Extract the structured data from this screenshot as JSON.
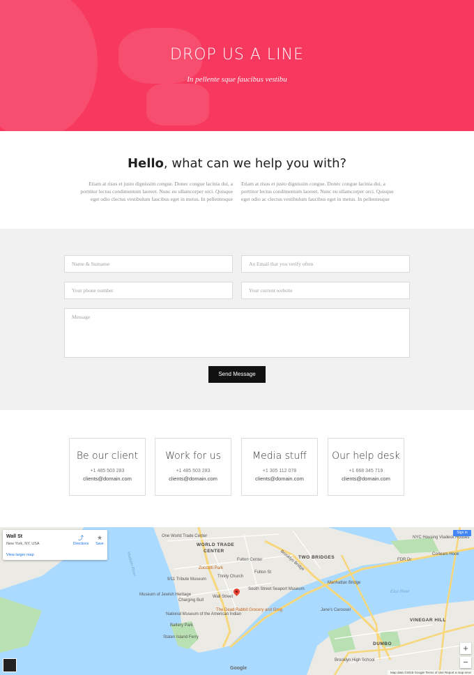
{
  "hero": {
    "title": "DROP US A LINE",
    "subtitle": "In pellente sque faucibus vestibu",
    "bg_color": "#f7395f"
  },
  "hello": {
    "title_bold": "Hello",
    "title_rest": ", what can we help you with?",
    "col_left": "Etiam at risus et justo dignissim congue. Donec congue lacinia dui, a porttitor lectus condimentum laoreet. Nunc eu ullamcorper orci. Quisque eget odio clectus vestibulum faucibus eget in metus. In pellentesque",
    "col_right": "Etiam at risus et justo dignissim congue. Donec congue lacinia dui, a porttitor lectus condimentum laoreet. Nunc eu ullamcorper orci. Quisque eget odio ac clectus vestibulum faucibus eget in metus. In pellentesque"
  },
  "form": {
    "name_placeholder": "Name & Surname",
    "email_placeholder": "An Email that you verify often",
    "phone_placeholder": "Your phone number",
    "website_placeholder": "Your current website",
    "message_placeholder": "Message",
    "send_label": "Send Message"
  },
  "cards": [
    {
      "title": "Be our client",
      "phone": "+1 485 503 283",
      "email": "clients@domain.com"
    },
    {
      "title": "Work for us",
      "phone": "+1 485 503 283",
      "email": "clients@domain.com"
    },
    {
      "title": "Media stuff",
      "phone": "+1 305 112 078",
      "email": "clients@domain.com"
    },
    {
      "title": "Our help desk",
      "phone": "+1 668 345 719",
      "email": "clients@domain.com"
    }
  ],
  "map": {
    "place_name": "Wall St",
    "place_address": "New York, NY, USA",
    "directions_label": "Directions",
    "save_label": "Save",
    "larger_map_label": "View larger map",
    "signin_label": "Sign in",
    "zoom_in": "+",
    "zoom_out": "−",
    "google_logo": "Google",
    "credits": "Map data ©2018 Google   Terms of Use   Report a map error",
    "labels": {
      "wtc": "WORLD TRADE",
      "wtc2": "CENTER",
      "two_bridges": "TWO BRIDGES",
      "vinegar_hill": "VINEGAR HILL",
      "dumbo": "DUMBO",
      "east_river": "East River",
      "hudson": "Hudson River",
      "one_wtc": "One World Trade Center",
      "fulton": "Fulton Center",
      "fulton_st": "Fulton St",
      "zuccotti": "Zuccotti Park",
      "tribute": "9/11 Tribute Museum",
      "trinity": "Trinity Church",
      "seaport": "South Street Seaport Museum",
      "wall_st": "Wall Street",
      "charging_bull": "Charging Bull",
      "jewish": "Museum of Jewish Heritage",
      "nmai": "National Museum of the American Indian",
      "dead_rabbit": "The Dead Rabbit Grocery and Grog",
      "battery": "Battery Park",
      "ferry": "Staten Island Ferry",
      "brooklyn_bridge": "Brooklyn Bridge",
      "manhattan_bridge": "Manhattan Bridge",
      "fdr": "FDR Dr",
      "corlears": "Corlears Hook",
      "nyc_housing": "NYC Housing Vladeck Houses",
      "janes": "Jane's Carousel",
      "brooklyn_hs": "Brooklyn High School"
    }
  }
}
